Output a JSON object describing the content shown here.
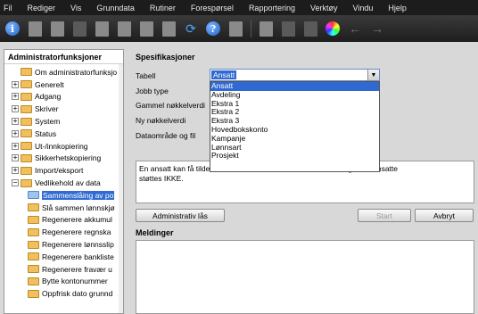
{
  "menu": [
    "Fil",
    "Rediger",
    "Vis",
    "Grunndata",
    "Rutiner",
    "Forespørsel",
    "Rapportering",
    "Verktøy",
    "Vindu",
    "Hjelp"
  ],
  "toolbar_icons": [
    "info-icon",
    "new-document-icon",
    "open-icon",
    "delete-icon",
    "copy-icon",
    "list-icon",
    "paste-icon",
    "print-icon",
    "refresh-icon",
    "help-icon",
    "find-icon",
    "separator",
    "chart-icon",
    "settings-icon",
    "disabled-icon",
    "color-wheel-icon",
    "back-arrow-icon",
    "forward-arrow-icon"
  ],
  "left_panel": {
    "title": "Administratorfunksjoner",
    "tree": [
      {
        "label": "Om administratorfunksjo",
        "expander": "",
        "level": 0
      },
      {
        "label": "Generelt",
        "expander": "+",
        "level": 0
      },
      {
        "label": "Adgang",
        "expander": "+",
        "level": 0
      },
      {
        "label": "Skriver",
        "expander": "+",
        "level": 0
      },
      {
        "label": "System",
        "expander": "+",
        "level": 0
      },
      {
        "label": "Status",
        "expander": "+",
        "level": 0
      },
      {
        "label": "Ut-/innkopiering",
        "expander": "+",
        "level": 0
      },
      {
        "label": "Sikkerhetskopiering",
        "expander": "+",
        "level": 0
      },
      {
        "label": "Import/eksport",
        "expander": "+",
        "level": 0
      },
      {
        "label": "Vedlikehold av data",
        "expander": "−",
        "level": 0
      },
      {
        "label": "Sammenslåing av po",
        "expander": "",
        "level": 1,
        "selected": true
      },
      {
        "label": "Slå sammen lønnskjø",
        "expander": "",
        "level": 1
      },
      {
        "label": "Regenerere akkumul",
        "expander": "",
        "level": 1
      },
      {
        "label": "Regenerere regnska",
        "expander": "",
        "level": 1
      },
      {
        "label": "Regenerere lønnsslip",
        "expander": "",
        "level": 1
      },
      {
        "label": "Regenerere bankliste",
        "expander": "",
        "level": 1
      },
      {
        "label": "Regenerere fravær u",
        "expander": "",
        "level": 1
      },
      {
        "label": "Bytte kontonummer",
        "expander": "",
        "level": 1
      },
      {
        "label": "Oppfrisk dato grunnd",
        "expander": "",
        "level": 1
      }
    ]
  },
  "spesifikasjoner": {
    "title": "Spesifikasjoner",
    "labels": [
      "Tabell",
      "Jobb type",
      "Gammel nøkkelverdi",
      "Ny nøkkelverdi",
      "Dataområde og fil"
    ],
    "tabell_value": "Ansatt",
    "dropdown_options": [
      "Ansatt",
      "Avdeling",
      "Ekstra 1",
      "Ekstra 2",
      "Ekstra 3",
      "Hovedbokskonto",
      "Kampanje",
      "Lønnsart",
      "Prosjekt"
    ],
    "description_left": "En ansatt kan få tilde",
    "description_right": "låing av to ansatte",
    "description_line2": "støttes IKKE."
  },
  "buttons": {
    "admin_lock": "Administrativ lås",
    "start": "Start",
    "cancel": "Avbryt"
  },
  "meldinger": {
    "title": "Meldinger"
  }
}
